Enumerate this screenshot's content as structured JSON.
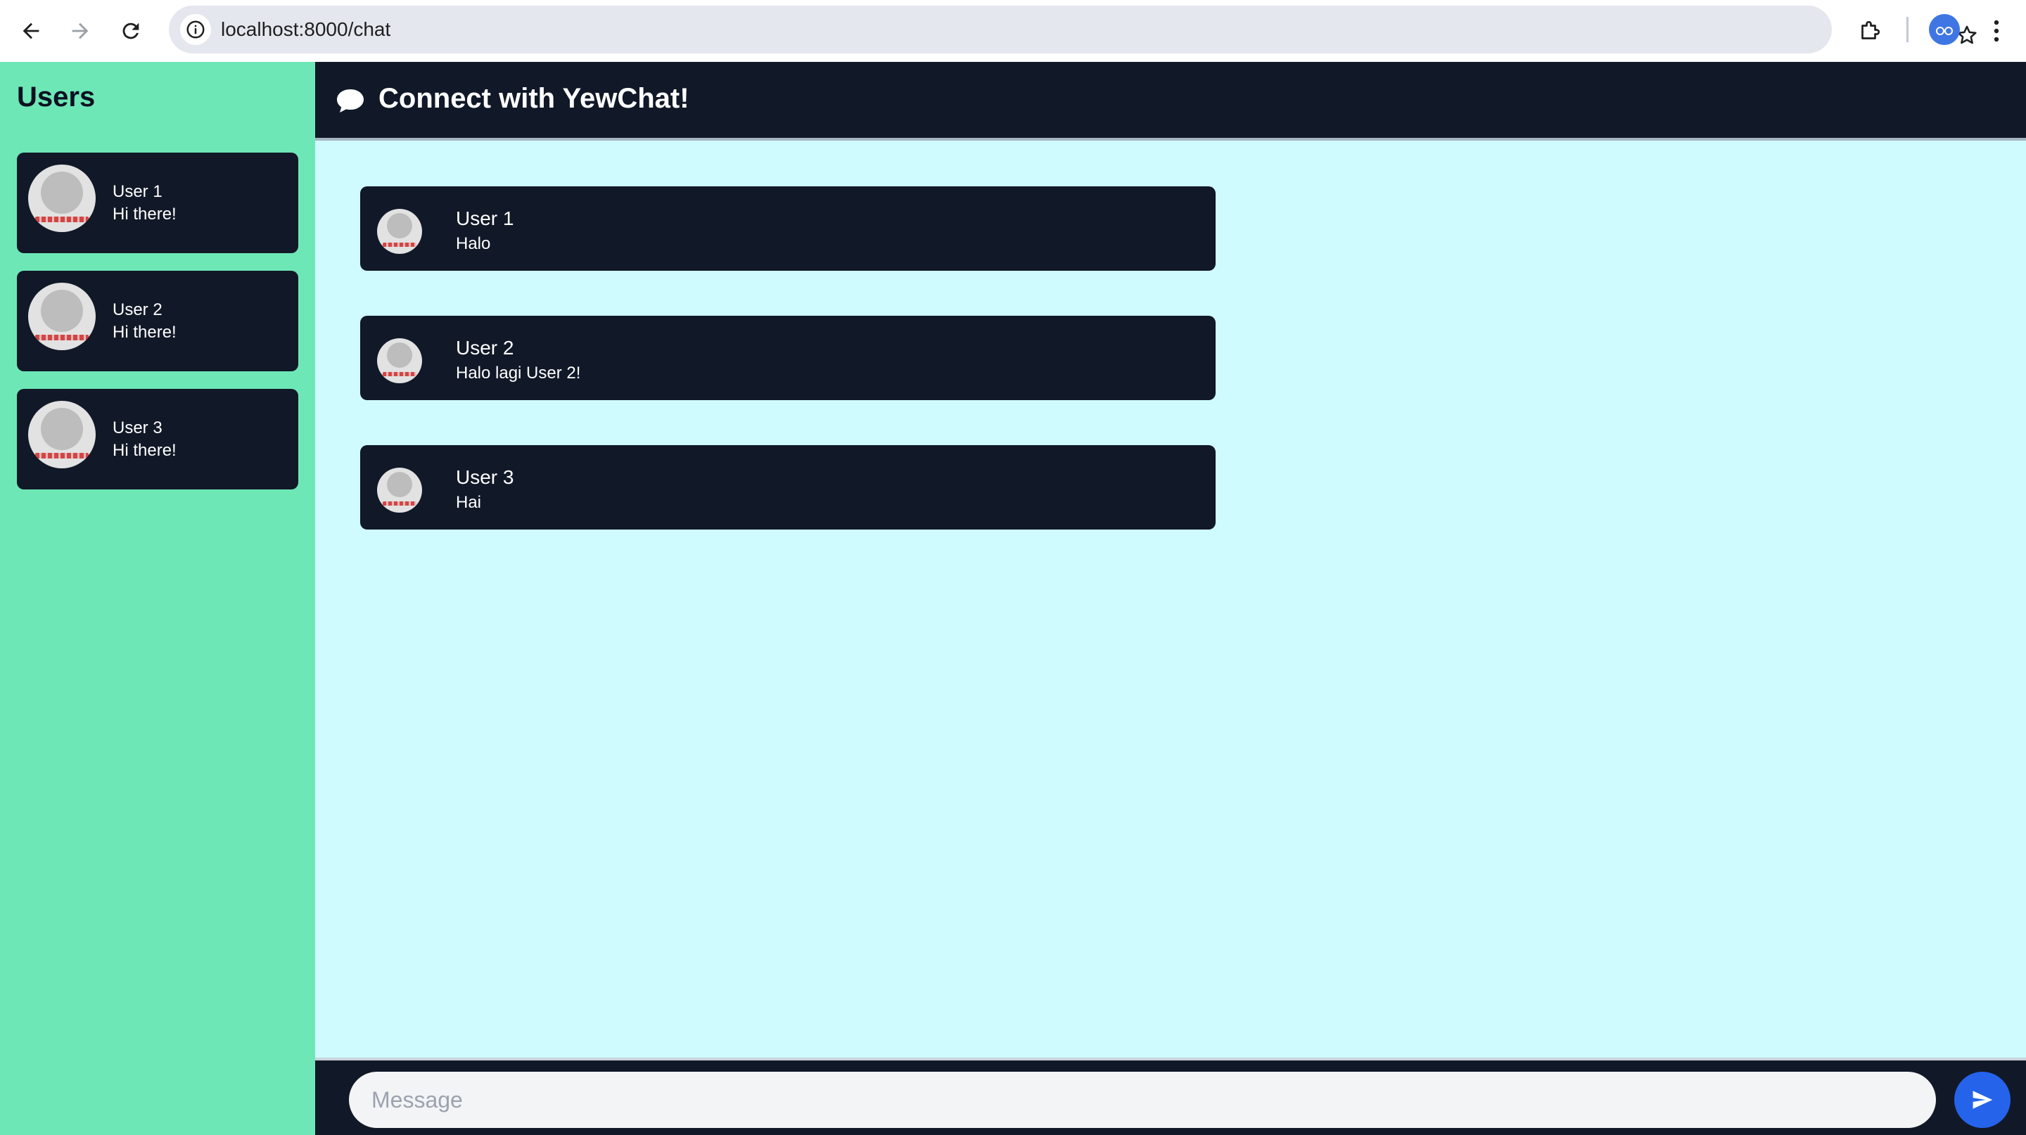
{
  "browser": {
    "url": "localhost:8000/chat"
  },
  "sidebar": {
    "title": "Users",
    "users": [
      {
        "name": "User 1",
        "status": "Hi there!"
      },
      {
        "name": "User 2",
        "status": "Hi there!"
      },
      {
        "name": "User 3",
        "status": "Hi there!"
      }
    ]
  },
  "header": {
    "icon": "chat-bubble-icon",
    "title": "Connect with YewChat!"
  },
  "messages": [
    {
      "from": "User 1",
      "text": "Halo"
    },
    {
      "from": "User 2",
      "text": "Halo lagi User 2!"
    },
    {
      "from": "User 3",
      "text": "Hai"
    }
  ],
  "composer": {
    "placeholder": "Message",
    "value": "",
    "send_icon": "send-icon"
  },
  "colors": {
    "sidebar_bg": "#6ee7b7",
    "dark": "#111827",
    "chat_bg": "#cffafe",
    "send_button": "#2563eb"
  }
}
